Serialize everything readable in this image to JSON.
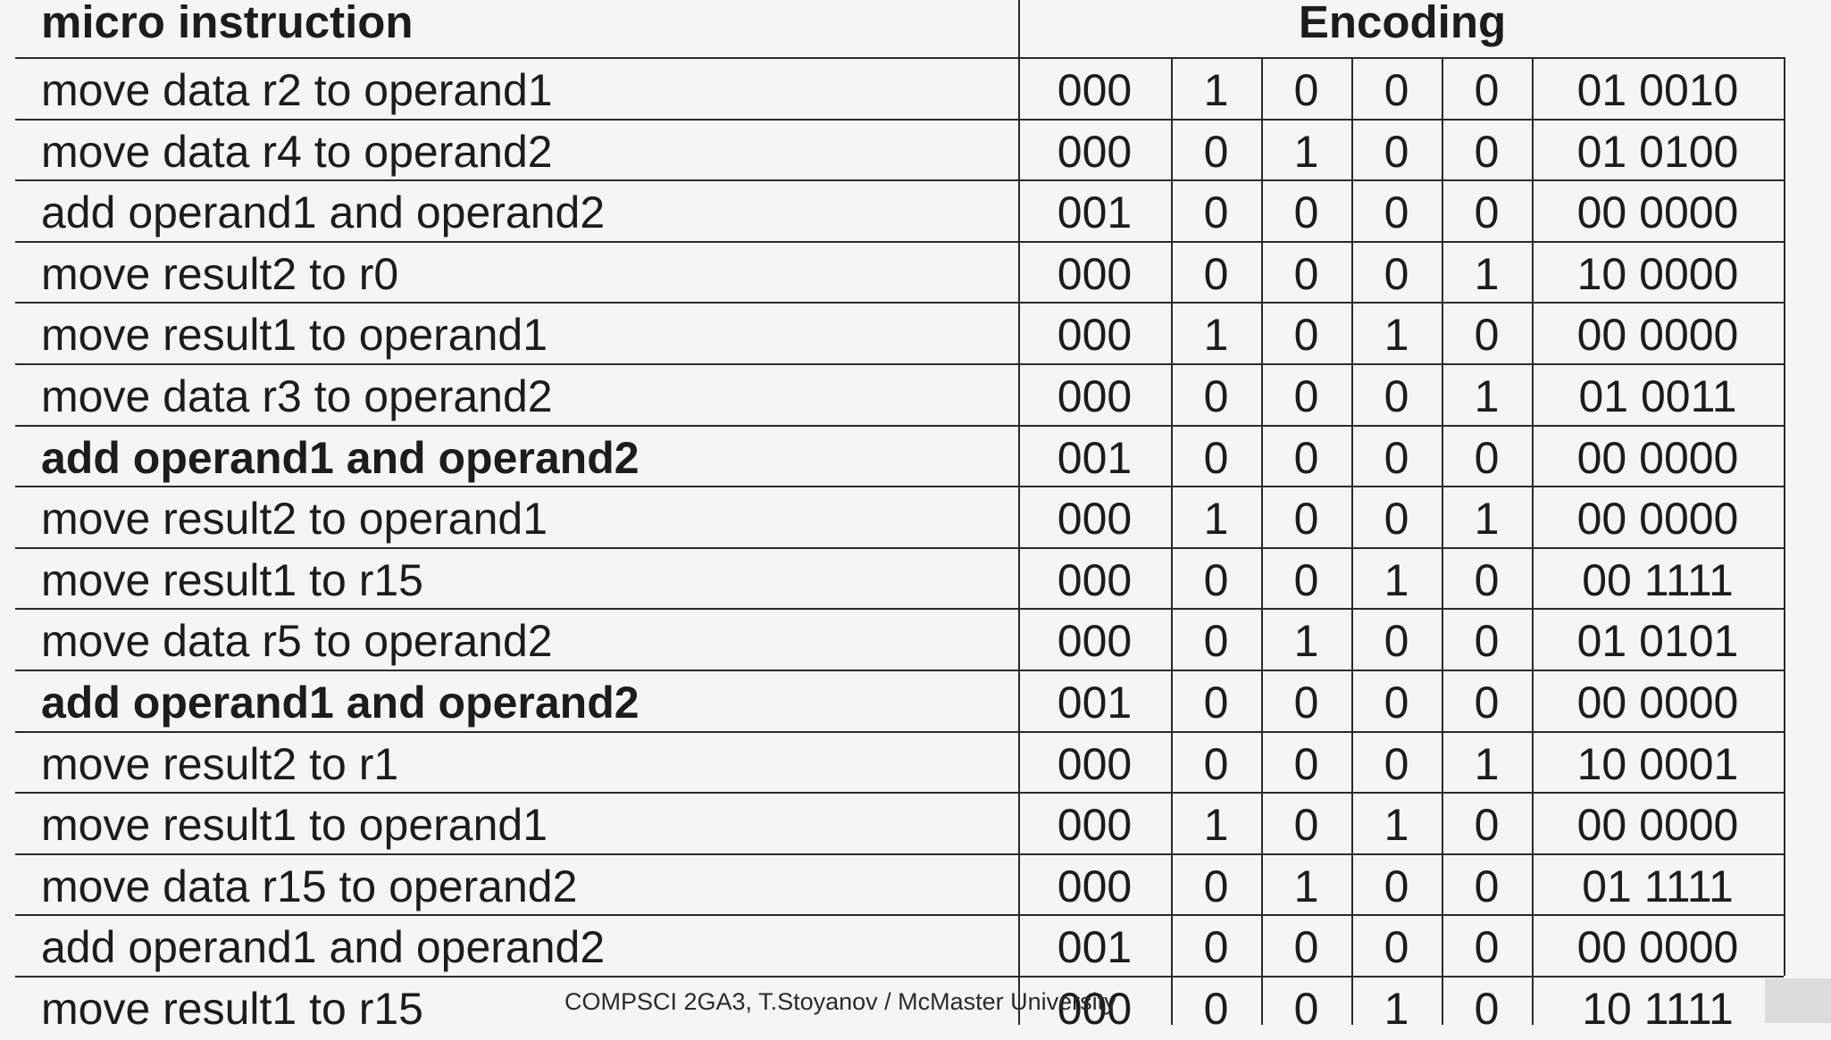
{
  "header": {
    "instruction_label": "micro instruction",
    "encoding_label": "Encoding"
  },
  "rows": [
    {
      "instruction": "move data r2 to operand1",
      "bold": false,
      "encoding": [
        "000",
        "1",
        "0",
        "0",
        "0",
        "01 0010"
      ]
    },
    {
      "instruction": "move data r4 to operand2",
      "bold": false,
      "encoding": [
        "000",
        "0",
        "1",
        "0",
        "0",
        "01 0100"
      ]
    },
    {
      "instruction": "add operand1 and operand2",
      "bold": false,
      "encoding": [
        "001",
        "0",
        "0",
        "0",
        "0",
        "00 0000"
      ]
    },
    {
      "instruction": "move result2 to r0",
      "bold": false,
      "encoding": [
        "000",
        "0",
        "0",
        "0",
        "1",
        "10 0000"
      ]
    },
    {
      "instruction": "move result1 to operand1",
      "bold": false,
      "encoding": [
        "000",
        "1",
        "0",
        "1",
        "0",
        "00 0000"
      ]
    },
    {
      "instruction": "move data r3 to operand2",
      "bold": false,
      "encoding": [
        "000",
        "0",
        "0",
        "0",
        "1",
        "01 0011"
      ]
    },
    {
      "instruction": "add operand1 and operand2",
      "bold": true,
      "encoding": [
        "001",
        "0",
        "0",
        "0",
        "0",
        "00 0000"
      ]
    },
    {
      "instruction": "move result2 to operand1",
      "bold": false,
      "encoding": [
        "000",
        "1",
        "0",
        "0",
        "1",
        "00 0000"
      ]
    },
    {
      "instruction": "move result1 to r15",
      "bold": false,
      "encoding": [
        "000",
        "0",
        "0",
        "1",
        "0",
        "00 1111"
      ]
    },
    {
      "instruction": "move data r5 to operand2",
      "bold": false,
      "encoding": [
        "000",
        "0",
        "1",
        "0",
        "0",
        "01 0101"
      ]
    },
    {
      "instruction": "add operand1 and operand2",
      "bold": true,
      "encoding": [
        "001",
        "0",
        "0",
        "0",
        "0",
        "00 0000"
      ]
    },
    {
      "instruction": "move result2 to r1",
      "bold": false,
      "encoding": [
        "000",
        "0",
        "0",
        "0",
        "1",
        "10 0001"
      ]
    },
    {
      "instruction": "move result1 to operand1",
      "bold": false,
      "encoding": [
        "000",
        "1",
        "0",
        "1",
        "0",
        "00 0000"
      ]
    },
    {
      "instruction": "move data r15 to operand2",
      "bold": false,
      "encoding": [
        "000",
        "0",
        "1",
        "0",
        "0",
        "01 1111"
      ]
    },
    {
      "instruction": "add operand1 and operand2",
      "bold": false,
      "encoding": [
        "001",
        "0",
        "0",
        "0",
        "0",
        "00 0000"
      ]
    },
    {
      "instruction": "move result1 to r15",
      "bold": false,
      "encoding": [
        "000",
        "0",
        "0",
        "1",
        "0",
        "10 1111"
      ]
    }
  ],
  "footer": "COMPSCI 2GA3, T.Stoyanov / McMaster University"
}
